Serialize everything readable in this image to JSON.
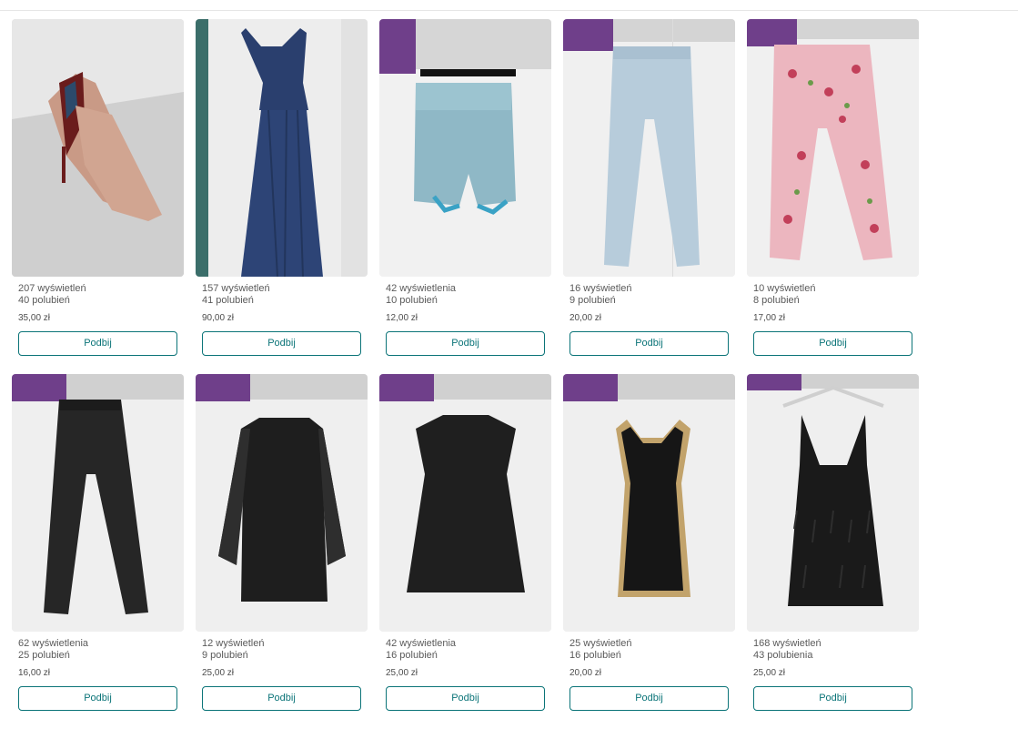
{
  "items": [
    {
      "views": "207 wyświetleń",
      "likes": "40 polubień",
      "price": "35,00 zł",
      "button": "Podbij",
      "photo": "photo-pink-heels"
    },
    {
      "views": "157 wyświetleń",
      "likes": "41 polubień",
      "price": "90,00 zł",
      "button": "Podbij",
      "photo": "photo-navy-gown"
    },
    {
      "views": "42 wyświetlenia",
      "likes": "10 polubień",
      "price": "12,00 zł",
      "button": "Podbij",
      "photo": "photo-blue-shorts"
    },
    {
      "views": "16 wyświetleń",
      "likes": "9 polubień",
      "price": "20,00 zł",
      "button": "Podbij",
      "photo": "photo-light-jeans"
    },
    {
      "views": "10 wyświetleń",
      "likes": "8 polubień",
      "price": "17,00 zł",
      "button": "Podbij",
      "photo": "photo-floral-pants"
    },
    {
      "views": "62 wyświetlenia",
      "likes": "25 polubień",
      "price": "16,00 zł",
      "button": "Podbij",
      "photo": "photo-black-coated-jeans"
    },
    {
      "views": "12 wyświetleń",
      "likes": "9 polubień",
      "price": "25,00 zł",
      "button": "Podbij",
      "photo": "photo-black-lace-sleeve-dress"
    },
    {
      "views": "42 wyświetlenia",
      "likes": "16 polubień",
      "price": "25,00 zł",
      "button": "Podbij",
      "photo": "photo-black-aline-dress"
    },
    {
      "views": "25 wyświetleń",
      "likes": "16 polubień",
      "price": "20,00 zł",
      "button": "Podbij",
      "photo": "photo-black-gold-trim-dress"
    },
    {
      "views": "168 wyświetleń",
      "likes": "43 polubienia",
      "price": "25,00 zł",
      "button": "Podbij",
      "photo": "photo-black-fringe-dress"
    }
  ],
  "colors": {
    "accent": "#0b7478",
    "text": "#4d4d4d",
    "divider": "#e6e6e6"
  }
}
